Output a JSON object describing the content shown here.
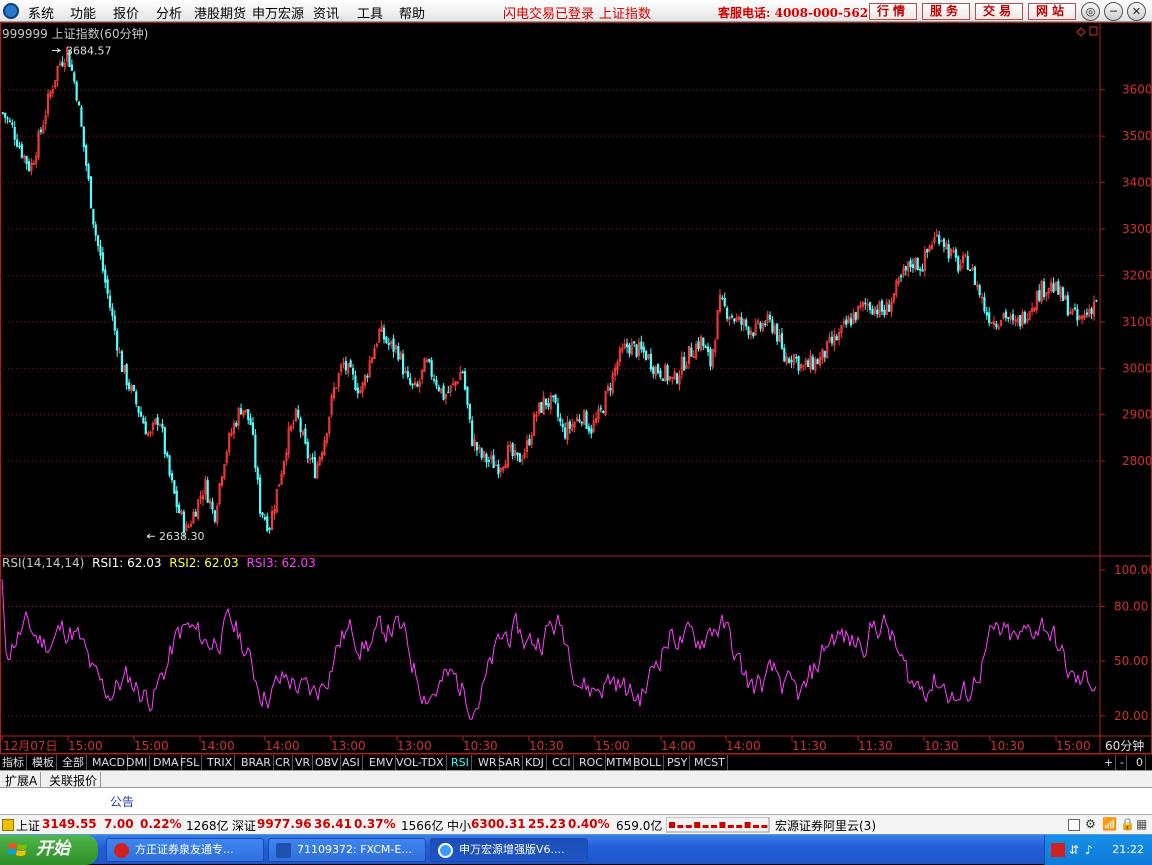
{
  "menubar": {
    "items": [
      "系统",
      "功能",
      "报价",
      "分析",
      "港股期货",
      "申万宏源",
      "资讯",
      "工具",
      "帮助"
    ],
    "flash_login": "闪电交易已登录",
    "index_link": "上证指数",
    "hotline": "客服电话: 4008-000-562",
    "buttons": [
      "行情",
      "服务",
      "交易",
      "网站"
    ]
  },
  "chart": {
    "title": "999999 上证指数(60分钟)",
    "high_label": "3684.57",
    "low_label": "2638.30",
    "y_labels": [
      "3600",
      "3500",
      "3400",
      "3300",
      "3200",
      "3100",
      "3000",
      "2900",
      "2800"
    ],
    "x_labels": [
      "12月07日",
      "15:00",
      "15:00",
      "14:00",
      "14:00",
      "13:00",
      "13:00",
      "10:30",
      "10:30",
      "15:00",
      "14:00",
      "14:00",
      "11:30",
      "11:30",
      "10:30",
      "10:30",
      "15:00"
    ],
    "period": "60分钟",
    "rsi_labels": [
      "100.00",
      "80.00",
      "50.00",
      "20.00"
    ],
    "rsi_legend": {
      "name": "RSI(14,14,14)",
      "rsi1": "RSI1: 62.03",
      "rsi2": "RSI2: 62.03",
      "rsi3": "RSI3: 62.03"
    }
  },
  "chart_data": [
    {
      "type": "candlestick",
      "title": "999999 上证指数(60分钟)",
      "ylim": [
        2600,
        3720
      ],
      "close_series": [
        3550,
        3520,
        3470,
        3430,
        3500,
        3580,
        3650,
        3684,
        3600,
        3450,
        3300,
        3200,
        3100,
        3000,
        2950,
        2900,
        2850,
        2900,
        2780,
        2700,
        2650,
        2700,
        2750,
        2680,
        2800,
        2870,
        2920,
        2880,
        2700,
        2660,
        2750,
        2850,
        2900,
        2820,
        2780,
        2850,
        2950,
        3010,
        2980,
        2950,
        3020,
        3080,
        3050,
        3040,
        2970,
        2950,
        3010,
        2980,
        2940,
        2960,
        3000,
        2850,
        2810,
        2800,
        2790,
        2820,
        2800,
        2830,
        2900,
        2930,
        2920,
        2860,
        2880,
        2900,
        2870,
        2900,
        2960,
        3020,
        3050,
        3040,
        3030,
        3000,
        2990,
        2970,
        3010,
        3040,
        3060,
        3010,
        3140,
        3120,
        3100,
        3090,
        3080,
        3100,
        3090,
        3020,
        3030,
        3000,
        3010,
        3020,
        3050,
        3070,
        3100,
        3120,
        3140,
        3130,
        3120,
        3160,
        3200,
        3230,
        3220,
        3270,
        3290,
        3250,
        3220,
        3230,
        3180,
        3120,
        3100,
        3120,
        3090,
        3110,
        3140,
        3170,
        3180,
        3160,
        3130,
        3100,
        3120,
        3150
      ],
      "high_label": 3684.57,
      "low_label": 2638.3
    },
    {
      "type": "line",
      "title": "RSI(14,14,14)",
      "ylim": [
        10,
        100
      ],
      "series": [
        {
          "name": "RSI1",
          "last": 62.03
        },
        {
          "name": "RSI2",
          "last": 62.03
        },
        {
          "name": "RSI3",
          "last": 62.03
        }
      ]
    }
  ],
  "tabs": [
    "指标",
    "模板",
    "全部",
    "MACD",
    "DMI",
    "DMA",
    "FSL",
    "TRIX",
    "BRAR",
    "CR",
    "VR",
    "OBV",
    "ASI",
    "EMV",
    "VOL-TDX",
    "RSI",
    "WR",
    "SAR",
    "KDJ",
    "CCI",
    "ROC",
    "MTM",
    "BOLL",
    "PSY",
    "MCST"
  ],
  "tabs_active": "RSI",
  "tab_nav": [
    "+",
    "-",
    "0"
  ],
  "ext_tabs": [
    "扩展A",
    "关联报价"
  ],
  "notice": "公告",
  "status": {
    "sh_label": "上证",
    "sh_val": "3149.55",
    "sh_chg": "7.00",
    "sh_pct": "0.22%",
    "sh_amt": "1268亿",
    "sz_label": "深证",
    "sz_val": "9977.96",
    "sz_chg": "36.41",
    "sz_pct": "0.37%",
    "sz_amt": "1566亿",
    "zx_label": "中小",
    "zx_val": "6300.31",
    "zx_chg": "25.23",
    "zx_pct": "0.40%",
    "zx_amt": "659.0亿",
    "server": "宏源证券阿里云(3)"
  },
  "taskbar": {
    "start": "开始",
    "tasks": [
      "方正证券泉友通专...",
      "71109372: FXCM-E...",
      "申万宏源增强版V6...."
    ],
    "clock": "21:22"
  },
  "colors": {
    "up": "#ff3c3c",
    "down": "#54ffff",
    "rsi": "#ff40ff",
    "grid": "#8a1a1a",
    "axis": "#b02020"
  }
}
